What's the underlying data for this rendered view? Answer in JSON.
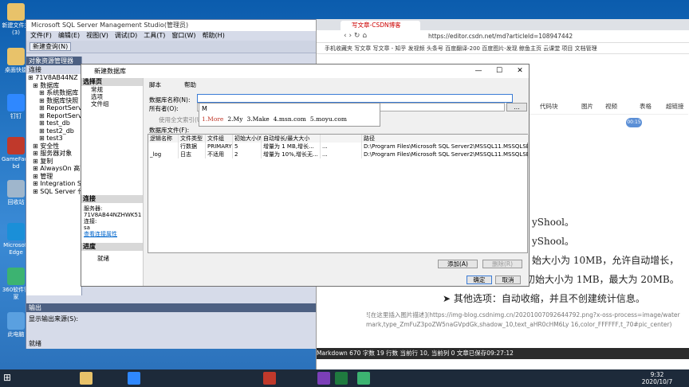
{
  "desktop": {
    "icons": [
      {
        "label": "新建文件夹 (3)",
        "color": "#e8c26a"
      },
      {
        "label": "桌面快捷",
        "color": "#e8c26a"
      },
      {
        "label": "钉钉",
        "color": "#2f88ff"
      },
      {
        "label": "GameFace bd",
        "color": "#c0392b"
      },
      {
        "label": "回收站",
        "color": "#9fb6cc"
      },
      {
        "label": "Microsoft Edge",
        "color": "#1a8fd8"
      },
      {
        "label": "360软件管家",
        "color": "#3cb371"
      },
      {
        "label": "此电脑",
        "color": "#5aa0e0"
      }
    ]
  },
  "ssms": {
    "title": "Microsoft SQL Server Management Studio(管理员)",
    "menu": [
      "文件(F)",
      "编辑(E)",
      "视图(V)",
      "调试(D)",
      "工具(T)",
      "窗口(W)",
      "帮助(H)"
    ],
    "new_query": "新建查询(N)",
    "object_explorer": {
      "title": "对象资源管理器",
      "connect": "连接",
      "tree": [
        "71V8AB44NZ",
        "数据库",
        "系统数据库",
        "数据库快照",
        "ReportServer",
        "ReportServerTempDB",
        "test_db",
        "test2_db",
        "test3",
        "安全性",
        "服务器对象",
        "复制",
        "AlwaysOn 高可用性",
        "管理",
        "Integration Services",
        "SQL Server 代理"
      ]
    },
    "output": {
      "title": "输出",
      "source_label": "显示输出来源(S):"
    },
    "status": "就绪"
  },
  "dialog": {
    "title": "新建数据库",
    "select_page": "选择页",
    "pages": [
      "常规",
      "选项",
      "文件组"
    ],
    "connection": "连接",
    "server_label": "服务器:",
    "server_value": "71V8AB44NZHWK51",
    "conn_label": "连接:",
    "conn_value": "sa",
    "view_conn": "查看连接属性",
    "progress": "进度",
    "progress_value": "就绪",
    "script": "脚本",
    "help": "帮助",
    "db_name_label": "数据库名称(N):",
    "owner_label": "所有者(O):",
    "owner_value": "M",
    "fulltext": "使用全文索引(U)",
    "files_label": "数据库文件(F):",
    "columns": [
      "逻辑名称",
      "文件类型",
      "文件组",
      "初始大小(MB)",
      "自动增长/最大大小",
      "",
      "路径"
    ],
    "rows": [
      [
        "",
        "行数据",
        "PRIMARY",
        "5",
        "增量为 1 MB,增长...",
        "...",
        "D:\\Program Files\\Microsoft SQL Server2\\MSSQL11.MSSQLSERVER\\M"
      ],
      [
        "_log",
        "日志",
        "不适用",
        "2",
        "增量为 10%,增长无...",
        "...",
        "D:\\Program Files\\Microsoft SQL Server2\\MSSQL11.MSSQLSERVER\\M"
      ]
    ],
    "add": "添加(A)",
    "remove": "删除(R)",
    "ok": "确定",
    "cancel": "取消"
  },
  "ime": {
    "input": "M",
    "candidates": [
      "1.More",
      "2.My",
      "3.Make",
      "4.msn.com",
      "5.moyu.com"
    ]
  },
  "browser": {
    "tab": "写文章-CSDN博客",
    "url": "https://editor.csdn.net/md?articleId=108947442",
    "bookmarks": "手机收藏夹   写文章   写文章 - 知乎   发视频   头条号   百度翻译-200   百度图片-发现   鲸鱼主页   云课堂   项目   文档管理",
    "toolbar": [
      "代码块",
      "图片",
      "视频",
      "表格",
      "超链接"
    ],
    "lines": [
      "yShool。",
      "yShool。",
      "始大小为 10MB，允许自动增长，",
      "初始大小为 1MB，最大为 20MB。",
      "其他选项：自动收缩，并且不创建统计信息。"
    ],
    "md_text": "![在这里插入图片描述](https://img-blog.csdnimg.cn/20201007092644792.png?x-oss-process=image/watermark,type_ZmFuZ3poZW5naGVpdGk,shadow_10,text_aHR0cHM6Ly 16,color_FFFFFF,t_70#pic_center)",
    "md_status": "Markdown  670 字数  19 行数  当前行 10, 当前列 0  文章已保存09:27:12",
    "badge": "00:15"
  },
  "taskbar": {
    "time": "9:32",
    "date": "2020/10/7"
  }
}
